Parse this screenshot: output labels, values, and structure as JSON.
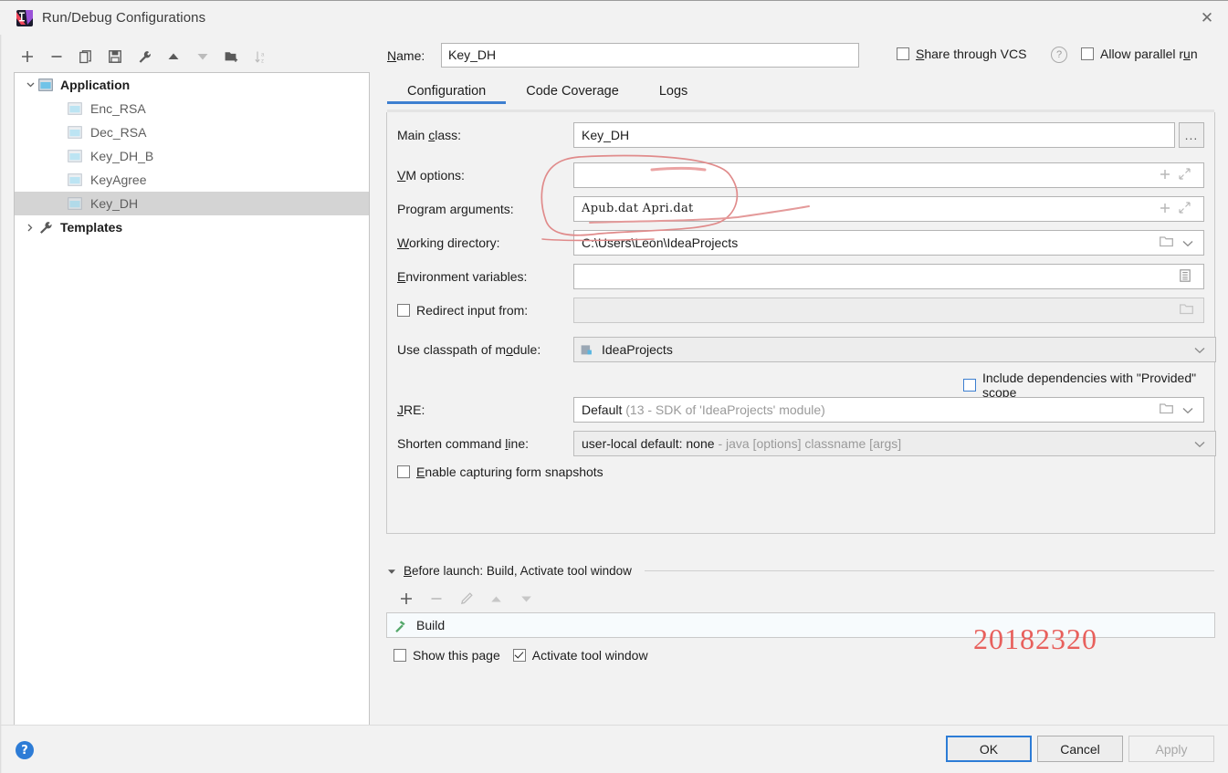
{
  "window": {
    "title": "Run/Debug Configurations",
    "app_icon": "intellij-idea-icon",
    "close_label": "✕"
  },
  "tree_toolbar": {
    "items": [
      {
        "name": "add-configuration-button",
        "glyph": "+",
        "enabled": true
      },
      {
        "name": "remove-configuration-button",
        "glyph": "−",
        "enabled": true
      },
      {
        "name": "copy-configuration-button",
        "glyph": "copy-icon",
        "enabled": true
      },
      {
        "name": "save-configuration-button",
        "glyph": "save-icon",
        "enabled": true
      },
      {
        "name": "edit-templates-button",
        "glyph": "wrench-icon",
        "enabled": true
      },
      {
        "name": "move-up-button",
        "glyph": "▲",
        "enabled": true
      },
      {
        "name": "move-down-button",
        "glyph": "▼",
        "enabled": false
      },
      {
        "name": "new-folder-button",
        "glyph": "folder-add-icon",
        "enabled": true
      },
      {
        "name": "sort-configurations-button",
        "glyph": "sort-az-icon",
        "enabled": false
      }
    ]
  },
  "tree": {
    "nodes": [
      {
        "label": "Application",
        "level": 0,
        "expanded": true,
        "selected": false,
        "twisty": "chevron-down"
      },
      {
        "label": "Enc_RSA",
        "level": 1,
        "expanded": false,
        "selected": false,
        "twisty": ""
      },
      {
        "label": "Dec_RSA",
        "level": 1,
        "expanded": false,
        "selected": false,
        "twisty": ""
      },
      {
        "label": "Key_DH_B",
        "level": 1,
        "expanded": false,
        "selected": false,
        "twisty": ""
      },
      {
        "label": "KeyAgree",
        "level": 1,
        "expanded": false,
        "selected": false,
        "twisty": ""
      },
      {
        "label": "Key_DH",
        "level": 1,
        "expanded": false,
        "selected": true,
        "twisty": ""
      },
      {
        "label": "Templates",
        "level": 0,
        "expanded": false,
        "selected": false,
        "twisty": "chevron-right"
      }
    ]
  },
  "header": {
    "name_label": "Name:",
    "name_label_mnemonic": "N",
    "name_value": "Key_DH",
    "share_vcs_label": "Share through VCS",
    "share_vcs_checked": false,
    "share_vcs_help": "?",
    "allow_parallel_label": "Allow parallel run",
    "allow_parallel_checked": false
  },
  "tabs": [
    {
      "label": "Configuration",
      "active": true
    },
    {
      "label": "Code Coverage",
      "active": false
    },
    {
      "label": "Logs",
      "active": false
    }
  ],
  "form": {
    "main_class": {
      "label": "Main class:",
      "value": "Key_DH",
      "browse_button": "..."
    },
    "vm_options": {
      "label": "VM options:",
      "value": "",
      "adornments": [
        "plus-icon",
        "expand-icon"
      ]
    },
    "program_arguments": {
      "label": "Program arguments:",
      "value": "Apub.dat Apri.dat",
      "adornments": [
        "plus-icon",
        "expand-icon"
      ]
    },
    "working_directory": {
      "label": "Working directory:",
      "value": "C:\\Users\\Leon\\IdeaProjects",
      "adornments": [
        "folder-icon",
        "chevron-down-icon"
      ]
    },
    "environment_variables": {
      "label": "Environment variables:",
      "value": "",
      "adornments": [
        "list-editor-icon"
      ]
    },
    "redirect_input": {
      "label": "Redirect input from:",
      "checked": false,
      "value": "",
      "adornments": [
        "folder-icon"
      ]
    },
    "use_classpath": {
      "label": "Use classpath of module:",
      "value": "IdeaProjects",
      "module_icon": "module-icon",
      "adornments": [
        "chevron-down-icon"
      ]
    },
    "include_dependencies": {
      "label": "Include dependencies with \"Provided\" scope",
      "checked": false
    },
    "jre": {
      "label": "JRE:",
      "value": "Default",
      "hint": "(13 - SDK of 'IdeaProjects' module)",
      "adornments": [
        "folder-icon",
        "chevron-down-icon"
      ]
    },
    "shorten_command_line": {
      "label": "Shorten command line:",
      "value": "user-local default: none",
      "hint": "- java [options] classname [args]",
      "adornments": [
        "chevron-down-icon"
      ]
    },
    "enable_form_snapshots": {
      "label": "Enable capturing form snapshots",
      "checked": false
    }
  },
  "before_launch": {
    "header": "Before launch: Build, Activate tool window",
    "toolbar": [
      {
        "name": "add-task-button",
        "glyph": "+",
        "enabled": true
      },
      {
        "name": "remove-task-button",
        "glyph": "−",
        "enabled": false
      },
      {
        "name": "edit-task-button",
        "glyph": "pencil-icon",
        "enabled": false
      },
      {
        "name": "move-task-up-button",
        "glyph": "▲",
        "enabled": false
      },
      {
        "name": "move-task-down-button",
        "glyph": "▼",
        "enabled": false
      }
    ],
    "tasks": [
      {
        "label": "Build",
        "icon": "hammer-icon"
      }
    ],
    "show_this_page": {
      "label": "Show this page",
      "checked": false
    },
    "activate_tool_window": {
      "label": "Activate tool window",
      "checked": true
    }
  },
  "annotation": {
    "watermark_text": "20182320",
    "watermark_color": "#e8605c",
    "ellipse_color": "#e08b8b"
  },
  "footer": {
    "help_icon": "help-icon",
    "ok_label": "OK",
    "cancel_label": "Cancel",
    "apply_label": "Apply",
    "apply_enabled": false
  }
}
